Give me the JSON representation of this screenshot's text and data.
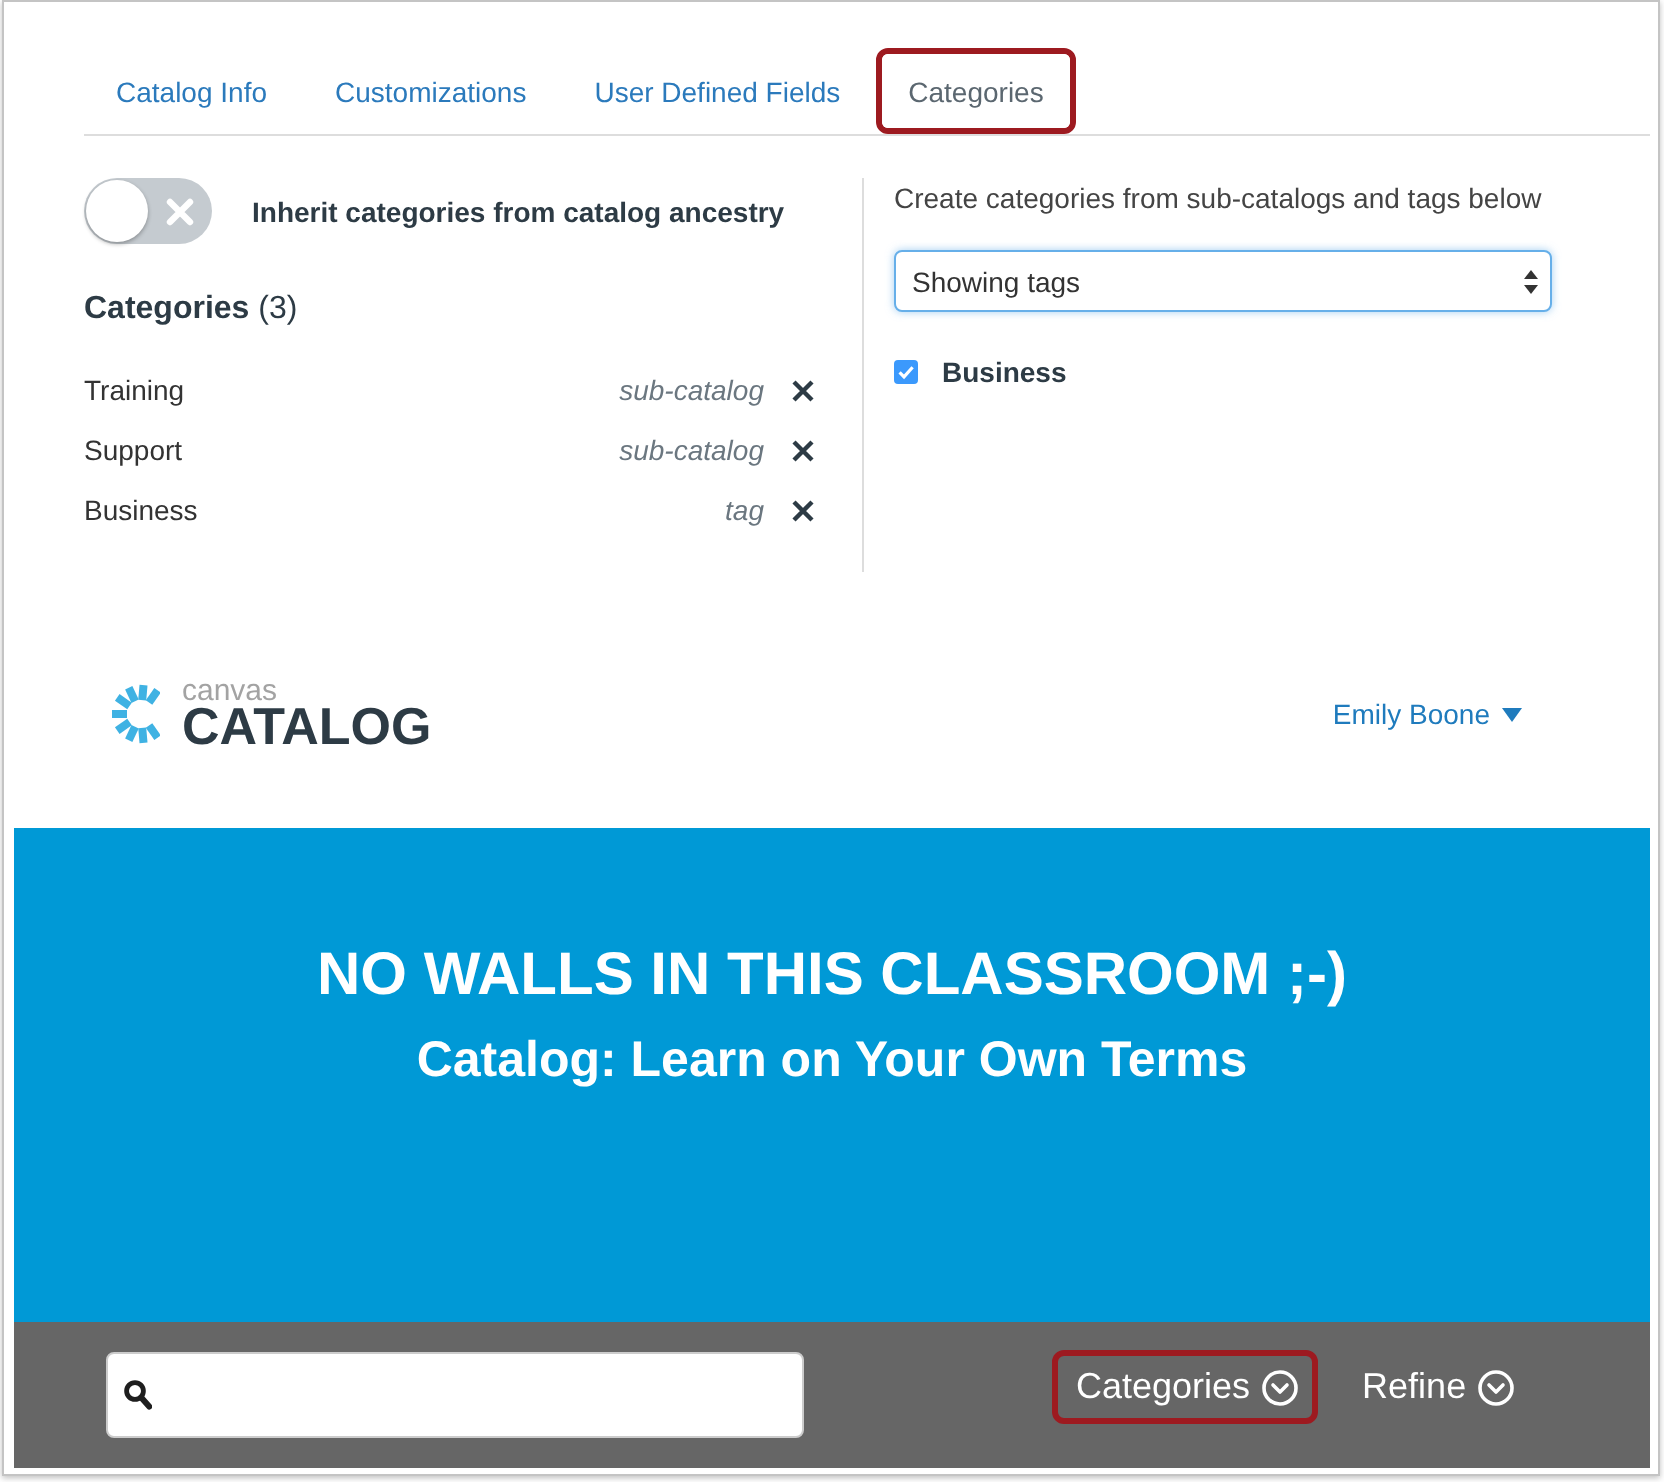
{
  "tabs": [
    {
      "label": "Catalog Info",
      "selected": false,
      "highlighted": false
    },
    {
      "label": "Customizations",
      "selected": false,
      "highlighted": false
    },
    {
      "label": "User Defined Fields",
      "selected": false,
      "highlighted": false
    },
    {
      "label": "Categories",
      "selected": true,
      "highlighted": true
    }
  ],
  "inherit_toggle": {
    "label": "Inherit categories from catalog ancestry",
    "on": false
  },
  "categories": {
    "heading": "**Categories** (3)",
    "items": [
      {
        "name": "Training",
        "type": "sub-catalog"
      },
      {
        "name": "Support",
        "type": "sub-catalog"
      },
      {
        "name": "Business",
        "type": "tag"
      }
    ]
  },
  "source_picker": {
    "instruction": "Create categories from sub-catalogs and tags below",
    "select_value": "Showing tags",
    "options": [
      {
        "label": "Business",
        "checked": true
      }
    ]
  },
  "header": {
    "logo_small": "canvas",
    "logo_large": "CATALOG",
    "user_menu": "Emily Boone"
  },
  "banner": {
    "title": "NO WALLS IN THIS CLASSROOM ;-)",
    "subtitle": "Catalog: Learn on Your Own Terms"
  },
  "filter_bar": {
    "menus": [
      {
        "label": "Categories",
        "highlighted": true
      },
      {
        "label": "Refine",
        "highlighted": false
      }
    ]
  }
}
